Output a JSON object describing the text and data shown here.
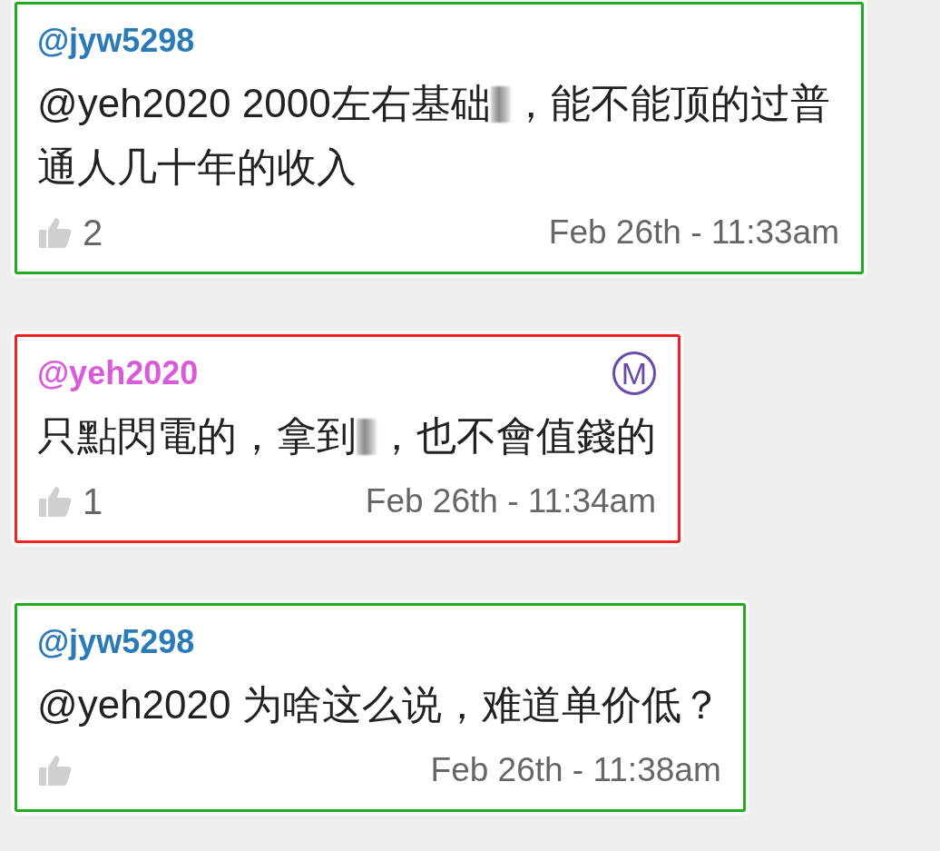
{
  "comments": [
    {
      "username": "@jyw5298",
      "kind": "member",
      "color": "#22aa22",
      "body": [
        {
          "kind": "text",
          "text": "@yeh2020 2000左右基础"
        },
        {
          "kind": "blur"
        },
        {
          "kind": "text",
          "text": "，能不能顶的过普通人几十年的收入"
        }
      ],
      "likes": "2",
      "time": "Feb 26th - 11:33am"
    },
    {
      "username": "@yeh2020",
      "kind": "moderator",
      "badge": "M",
      "color": "#ee2222",
      "body": [
        {
          "kind": "text",
          "text": "只點閃電的，拿到"
        },
        {
          "kind": "blur"
        },
        {
          "kind": "text",
          "text": "，也不會值錢的"
        }
      ],
      "likes": "1",
      "time": "Feb 26th - 11:34am"
    },
    {
      "username": "@jyw5298",
      "kind": "member",
      "color": "#22aa22",
      "body": [
        {
          "kind": "text",
          "text": "@yeh2020 为啥这么说，难道单价低？"
        }
      ],
      "time": "Feb 26th - 11:38am"
    }
  ]
}
